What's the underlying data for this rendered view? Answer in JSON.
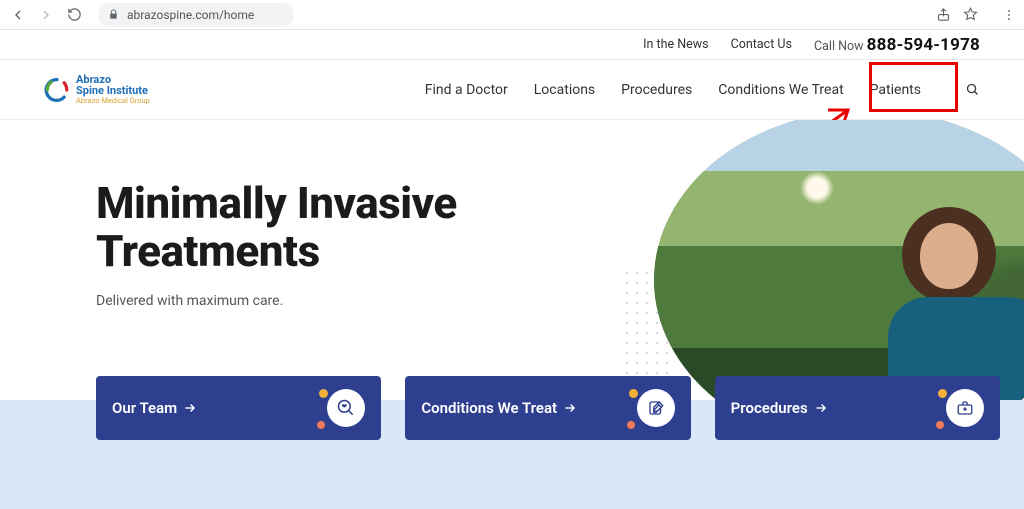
{
  "browser": {
    "url": "abrazospine.com/home"
  },
  "utility": {
    "news": "In the News",
    "contact": "Contact Us",
    "call_label": "Call Now",
    "phone": "888-594-1978"
  },
  "logo": {
    "line1": "Abrazo",
    "line2": "Spine Institute",
    "line3": "Abrazo Medical Group"
  },
  "nav": {
    "find_doctor": "Find a Doctor",
    "locations": "Locations",
    "procedures": "Procedures",
    "conditions": "Conditions We Treat",
    "patients": "Patients"
  },
  "hero": {
    "title_l1": "Minimally Invasive",
    "title_l2": "Treatments",
    "sub": "Delivered with maximum care."
  },
  "cards": {
    "team": "Our Team",
    "conditions": "Conditions We Treat",
    "procedures": "Procedures"
  },
  "annotation": {
    "highlighted_nav_item": "patients"
  }
}
